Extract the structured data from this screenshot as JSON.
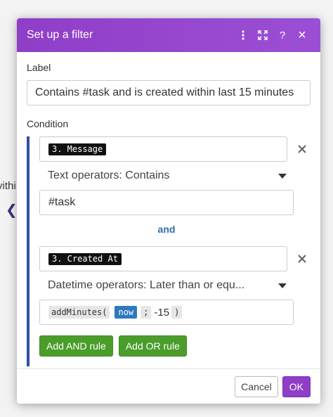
{
  "background": {
    "partial_text": "vithi"
  },
  "dialog": {
    "title": "Set up a filter",
    "accent_color": "#8f3ec7",
    "header_icons": [
      "more-vertical-icon",
      "expand-icon",
      "help-icon",
      "close-icon"
    ],
    "help_glyph": "?",
    "close_glyph": "×",
    "label_field": {
      "label": "Label",
      "value": "Contains #task and is created within last 15 minutes"
    },
    "condition": {
      "label": "Condition",
      "conditions": [
        {
          "field_tag": "3. Message",
          "operator": "Text operators: Contains",
          "value": "#task"
        },
        {
          "field_tag": "3. Created At",
          "operator": "Datetime operators: Later than or equ...",
          "value": {
            "function": "addMinutes(",
            "keyword": "now",
            "separator": ";",
            "number": "-15",
            "close": ")"
          }
        }
      ],
      "and_label": "and"
    },
    "buttons": {
      "add_and": "Add AND rule",
      "add_or": "Add OR rule",
      "cancel": "Cancel",
      "ok": "OK"
    }
  }
}
